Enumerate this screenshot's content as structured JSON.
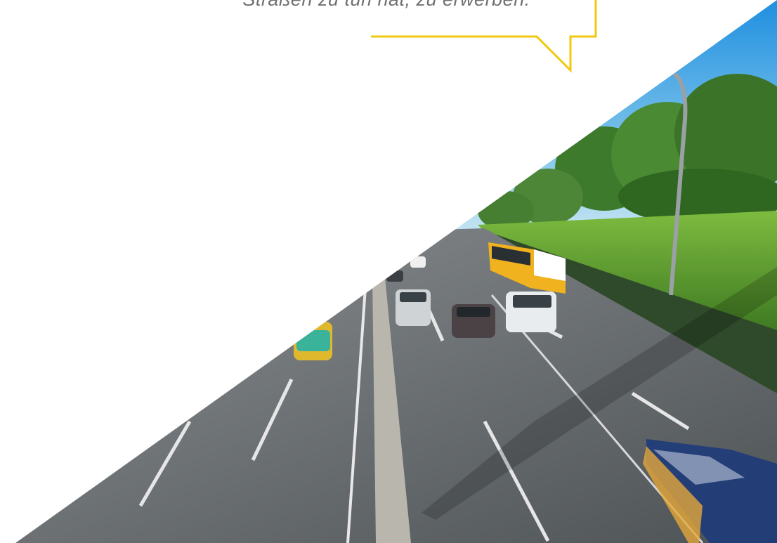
{
  "quote": {
    "text": "Straßen zu tun hat, zu erwerben."
  },
  "colors": {
    "bubble_outline": "#f2c80f",
    "sky": "#3f9fdc",
    "grass": "#6eaa3a",
    "road": "#6b6f72",
    "background": "#ffffff"
  },
  "photo": {
    "subject": "multi-lane highway with bus, taxis and cars, trees and grass embankment"
  }
}
